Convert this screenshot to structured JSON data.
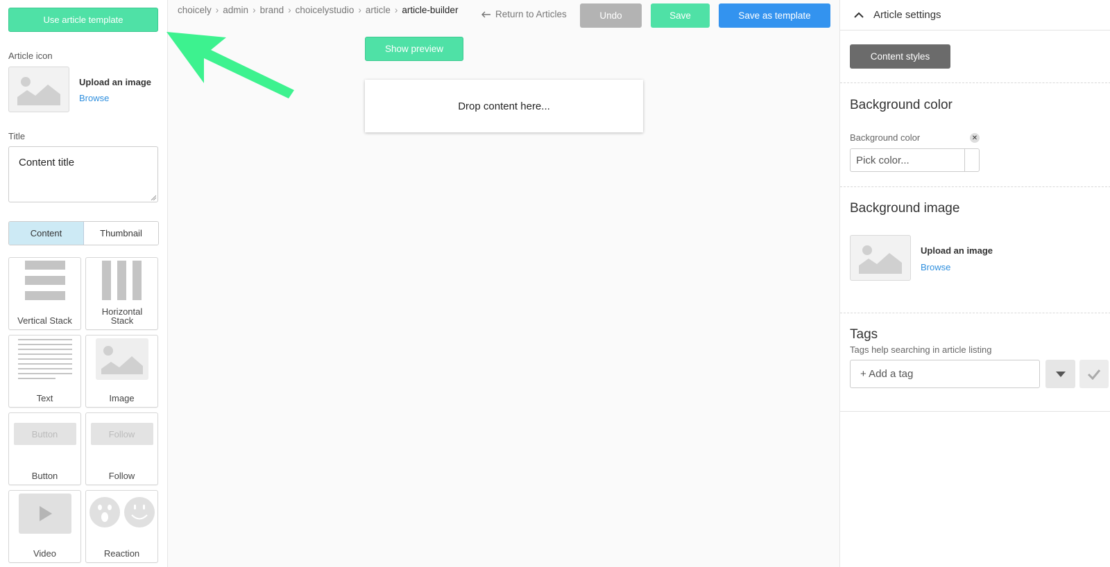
{
  "left": {
    "use_template_label": "Use article template",
    "article_icon_label": "Article icon",
    "upload_title": "Upload an image",
    "browse_label": "Browse",
    "title_label": "Title",
    "title_value": "Content title",
    "tabs": [
      {
        "label": "Content",
        "active": true
      },
      {
        "label": "Thumbnail",
        "active": false
      }
    ],
    "components": [
      {
        "label": "Vertical Stack",
        "icon": "vertical-stack-icon"
      },
      {
        "label": "Horizontal Stack",
        "icon": "horizontal-stack-icon"
      },
      {
        "label": "Text",
        "icon": "text-icon"
      },
      {
        "label": "Image",
        "icon": "image-icon"
      },
      {
        "label": "Button",
        "icon": "button-icon",
        "preview_text": "Button"
      },
      {
        "label": "Follow",
        "icon": "follow-icon",
        "preview_text": "Follow"
      },
      {
        "label": "Video",
        "icon": "video-icon"
      },
      {
        "label": "Reaction",
        "icon": "reaction-icon"
      }
    ]
  },
  "breadcrumb": [
    "choicely",
    "admin",
    "brand",
    "choicelystudio",
    "article",
    "article-builder"
  ],
  "toolbar": {
    "return_label": "Return to Articles",
    "undo_label": "Undo",
    "save_label": "Save",
    "save_template_label": "Save as template",
    "show_preview_label": "Show preview"
  },
  "canvas": {
    "drop_text": "Drop content here..."
  },
  "right": {
    "header_title": "Article settings",
    "content_styles_label": "Content styles",
    "bg_color_heading": "Background color",
    "bg_color_label": "Background color",
    "bg_color_placeholder": "Pick color...",
    "bg_image_heading": "Background image",
    "upload_title": "Upload an image",
    "browse_label": "Browse",
    "tags_heading": "Tags",
    "tags_help": "Tags help searching in article listing",
    "tag_placeholder": "+ Add a tag"
  },
  "colors": {
    "accent_green": "#4fe1a6",
    "primary_blue": "#3393ef",
    "undo_gray": "#b3b3b3",
    "arrow_green": "#3df28f"
  }
}
